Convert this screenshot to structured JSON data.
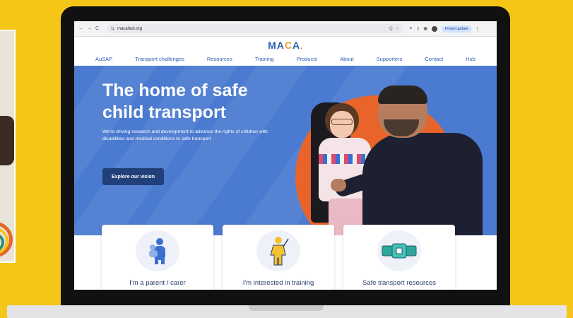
{
  "browser": {
    "back": "←",
    "forward": "→",
    "reload": "C",
    "tune": "⇆",
    "url": "macahub.org",
    "zoom": "Q",
    "star": "☆",
    "finish_update": "Finish update",
    "kebab": "⋮"
  },
  "site": {
    "logo_main": "MA",
    "logo_c": "C",
    "logo_end": "A",
    "logo_dot": "."
  },
  "nav": [
    "AuSAP",
    "Transport challenges",
    "Resources",
    "Training",
    "Products",
    "About",
    "Supporters",
    "Contact",
    "Hub"
  ],
  "hero": {
    "title": "The home of safe child transport",
    "body": "We're driving research and development to advance the rights of children with disabilities and medical conditions to safe transport",
    "cta": "Explore our vision"
  },
  "cards": [
    {
      "title": "I'm a parent / carer",
      "icon": "parent-carer-icon"
    },
    {
      "title": "I'm interested in training",
      "icon": "training-icon"
    },
    {
      "title": "Safe transport resources",
      "icon": "seatbelt-icon"
    }
  ],
  "colors": {
    "background": "#f5c518",
    "hero": "#4b7bd1",
    "cta": "#21407a",
    "accent_orange": "#e8642a",
    "brand_blue": "#2b5fb3"
  }
}
